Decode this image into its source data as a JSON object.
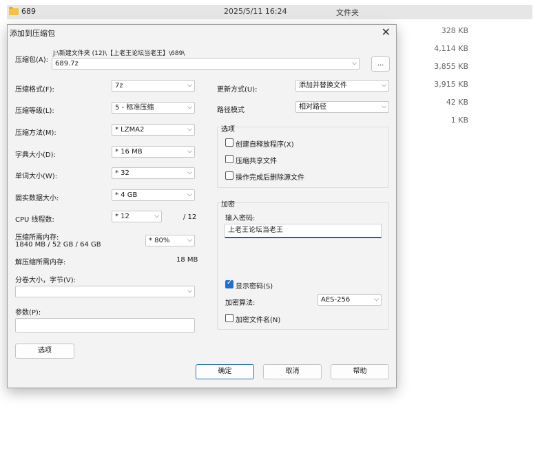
{
  "explorer": {
    "folder_name": "689",
    "date": "2025/5/11 16:24",
    "type": "文件夹",
    "sizes": [
      "328 KB",
      "4,114 KB",
      "3,855 KB",
      "3,915 KB",
      "42 KB",
      "1 KB"
    ]
  },
  "dialog": {
    "title": "添加到压缩包",
    "archive_label": "压缩包(A):",
    "archive_path": "J:\\新建文件夹 (12)\\【上老王论坛当老王】\\689\\",
    "archive_name": "689.7z",
    "browse_label": "...",
    "format_label": "压缩格式(F):",
    "format_value": "7z",
    "level_label": "压缩等级(L):",
    "level_value": "5 - 标准压缩",
    "method_label": "压缩方法(M):",
    "method_value": "* LZMA2",
    "dict_label": "字典大小(D):",
    "dict_value": "* 16 MB",
    "word_label": "单词大小(W):",
    "word_value": "* 32",
    "solid_label": "固实数据大小:",
    "solid_value": "* 4 GB",
    "threads_label": "CPU 线程数:",
    "threads_value": "* 12",
    "threads_total": "/ 12",
    "mem_label": "压缩所需内存:",
    "mem_value": "1840 MB / 52 GB / 64 GB",
    "mem_percent": "* 80%",
    "decomp_label": "解压缩所需内存:",
    "decomp_value": "18 MB",
    "split_label": "分卷大小，字节(V):",
    "split_value": "",
    "params_label": "参数(P):",
    "params_value": "",
    "options_button": "选项",
    "update_label": "更新方式(U):",
    "update_value": "添加并替换文件",
    "path_label": "路径模式",
    "path_value": "相对路径",
    "options_group": "选项",
    "opt_sfx": "创建自释放程序(X)",
    "opt_shared": "压缩共享文件",
    "opt_delete": "操作完成后删除源文件",
    "encrypt_group": "加密",
    "password_label": "输入密码:",
    "password_value": "上老王论坛当老王",
    "show_password": "显示密码(S)",
    "enc_method_label": "加密算法:",
    "enc_method_value": "AES-256",
    "encrypt_names": "加密文件名(N)",
    "ok": "确定",
    "cancel": "取消",
    "help": "帮助"
  }
}
